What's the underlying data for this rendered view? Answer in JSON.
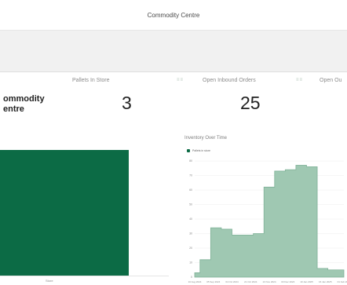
{
  "app": {
    "title": "Commodity Centre"
  },
  "stats": [
    {
      "label": "Pallets In Store",
      "value": "3"
    },
    {
      "label": "Open Inbound Orders",
      "value": "25"
    },
    {
      "label": "Open Ou"
    }
  ],
  "site": {
    "title_line1": "ommodity",
    "title_line2": "entre"
  },
  "left_chart": {
    "tick": "Store"
  },
  "chart": {
    "title": "Inventory Over Time",
    "legend": "Pallets in store",
    "y_ticks": [
      "80",
      "70",
      "60",
      "50",
      "40",
      "30",
      "20",
      "10",
      "0"
    ],
    "x_ticks": [
      "10 Aug 2024",
      "05 Sep 2024",
      "04 Oct 2024",
      "21 Oct 2024",
      "13 Nov 2024",
      "03 Dec 2024",
      "19 Jan 2025",
      "16 Jan 2025",
      "01 Feb 2025"
    ]
  },
  "chart_data": {
    "type": "area",
    "title": "Inventory Over Time",
    "xlabel": "",
    "ylabel": "",
    "ylim": [
      0,
      80
    ],
    "grid": true,
    "legend": "top-left",
    "series": [
      {
        "name": "Pallets in store",
        "x": [
          "10 Aug 2024",
          "20 Aug 2024",
          "05 Sep 2024",
          "20 Sep 2024",
          "04 Oct 2024",
          "12 Oct 2024",
          "21 Oct 2024",
          "01 Nov 2024",
          "13 Nov 2024",
          "25 Nov 2024",
          "03 Dec 2024",
          "05 Dec 2024",
          "19 Jan 2025",
          "16 Jan 2025",
          "01 Feb 2025"
        ],
        "values": [
          3,
          12,
          34,
          33,
          29,
          29,
          30,
          62,
          73,
          74,
          77,
          76,
          6,
          5,
          5
        ]
      }
    ],
    "colors": {
      "fill": "#9fc8b2",
      "stroke": "#7fb197",
      "left_bar": "#0c6b45"
    }
  }
}
